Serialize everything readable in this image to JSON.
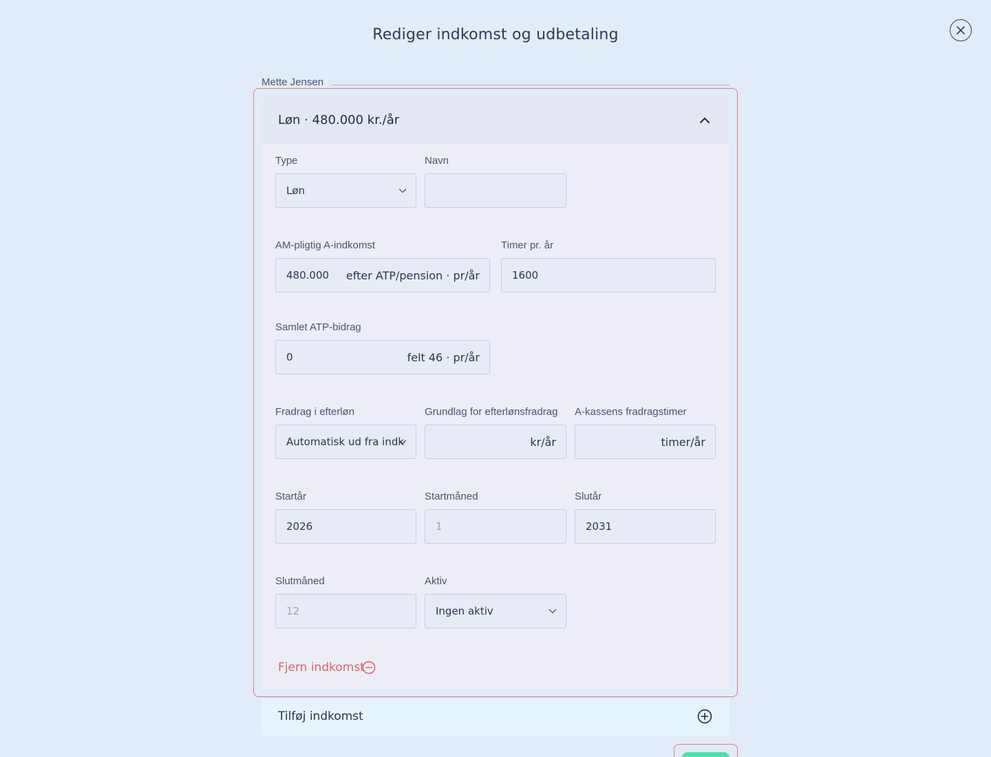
{
  "modal": {
    "title": "Rediger indkomst og udbetaling"
  },
  "person": {
    "name": "Mette Jensen"
  },
  "income": {
    "header": "Løn · 480.000 kr./år",
    "type": {
      "label": "Type",
      "value": "Løn"
    },
    "name": {
      "label": "Navn",
      "value": ""
    },
    "am_income": {
      "label": "AM-pligtig A-indkomst",
      "value": "480.000",
      "suffix": "efter ATP/pension · pr/år"
    },
    "hours": {
      "label": "Timer pr. år",
      "value": "1600"
    },
    "atp": {
      "label": "Samlet ATP-bidrag",
      "value": "0",
      "suffix": "felt 46 · pr/år"
    },
    "deduction": {
      "label": "Fradrag i efterløn",
      "value": "Automatisk ud fra indkomst"
    },
    "deduction_basis": {
      "label": "Grundlag for efterlønsfradrag",
      "value": "",
      "suffix": "kr/år"
    },
    "akasse_hours": {
      "label": "A-kassens fradragstimer",
      "value": "",
      "suffix": "timer/år"
    },
    "start_year": {
      "label": "Startår",
      "value": "2026"
    },
    "start_month": {
      "label": "Startmåned",
      "placeholder": "1"
    },
    "end_year": {
      "label": "Slutår",
      "value": "2031"
    },
    "end_month": {
      "label": "Slutmåned",
      "placeholder": "12"
    },
    "active": {
      "label": "Aktiv",
      "value": "Ingen aktiv"
    },
    "remove_label": "Fjern indkomst"
  },
  "add_income_label": "Tilføj indkomst",
  "colors": {
    "background": "#e2ebf8",
    "danger": "#d9646a",
    "accent_green": "#4de0ae"
  },
  "icons": [
    "close-icon",
    "chevron-up-icon",
    "chevron-down-icon",
    "minus-circle-icon",
    "plus-circle-icon"
  ]
}
